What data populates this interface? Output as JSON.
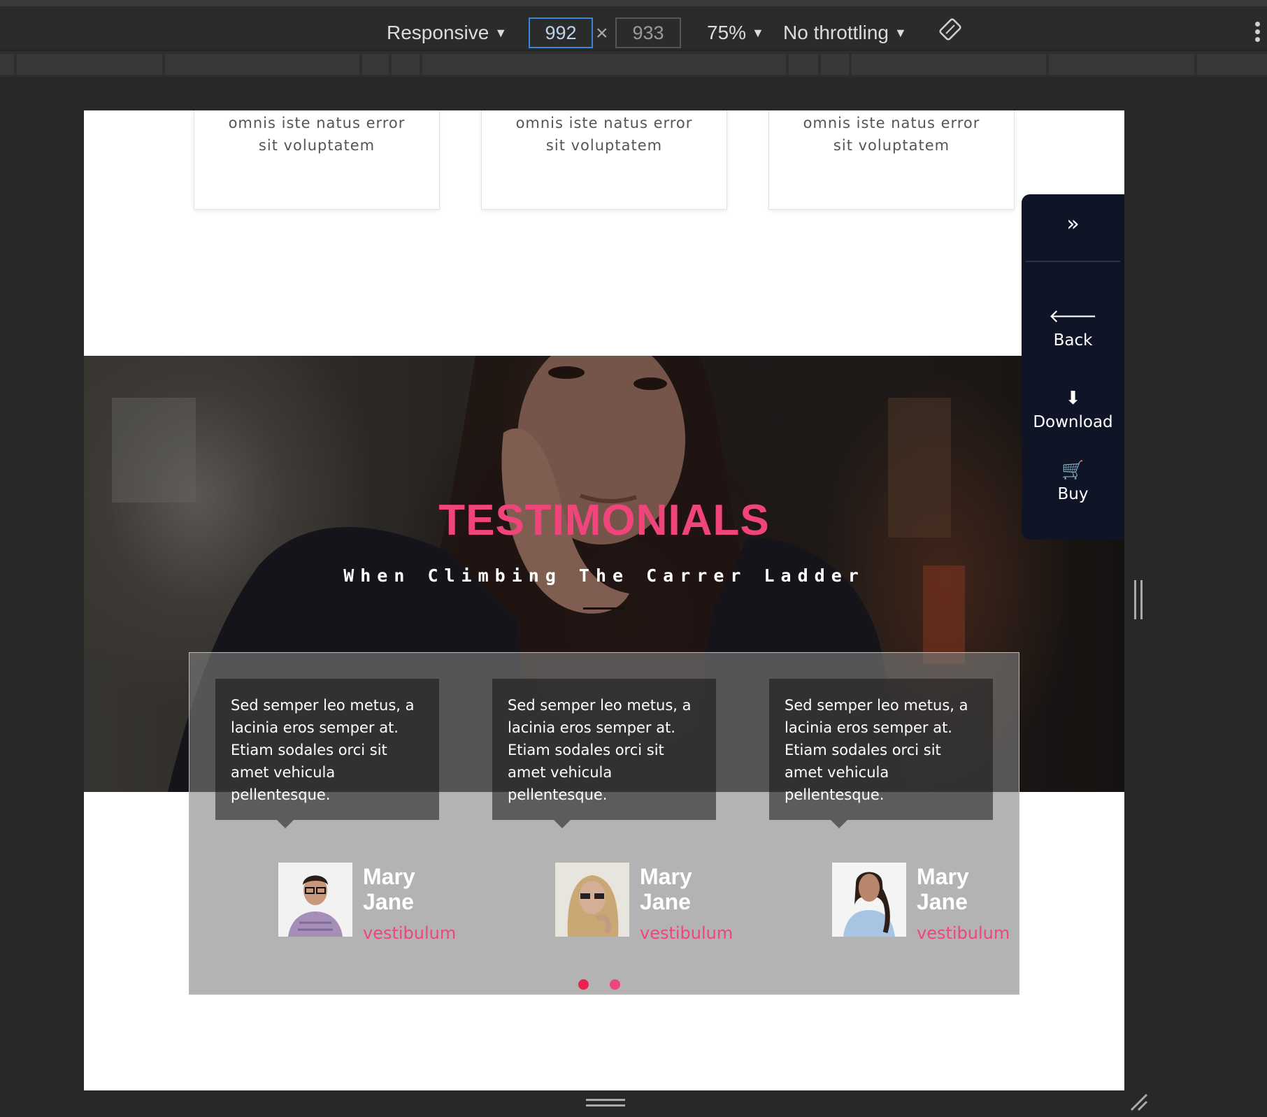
{
  "devtools": {
    "device_label": "Responsive",
    "width_value": "992",
    "height_value": "933",
    "times_symbol": "×",
    "zoom_label": "75%",
    "throttling_label": "No throttling",
    "caret": "▼",
    "rotate_icon": "rotate-icon",
    "more_icon": "more-vertical-icon"
  },
  "services": {
    "cards": [
      {
        "line1": "omnis iste natus error",
        "line2": "sit voluptatem"
      },
      {
        "line1": "omnis iste natus error",
        "line2": "sit voluptatem"
      },
      {
        "line1": "omnis iste natus error",
        "line2": "sit voluptatem"
      }
    ]
  },
  "hero": {
    "title": "TESTIMONIALS",
    "subtitle": "When Climbing The Carrer Ladder"
  },
  "testimonials": [
    {
      "quote": "Sed semper leo metus, a lacinia eros semper at. Etiam sodales orci sit amet vehicula pellentesque.",
      "first": "Mary",
      "last": "Jane",
      "role": "vestibulum"
    },
    {
      "quote": "Sed semper leo metus, a lacinia eros semper at. Etiam sodales orci sit amet vehicula pellentesque.",
      "first": "Mary",
      "last": "Jane",
      "role": "vestibulum"
    },
    {
      "quote": "Sed semper leo metus, a lacinia eros semper at. Etiam sodales orci sit amet vehicula pellentesque.",
      "first": "Mary",
      "last": "Jane",
      "role": "vestibulum"
    }
  ],
  "side_panel": {
    "collapse_icon": "»",
    "back_icon": "🡐",
    "back_label": "Back",
    "download_icon": "⬇",
    "download_label": "Download",
    "buy_icon": "🛒",
    "buy_label": "Buy"
  },
  "colors": {
    "accent": "#f0457a",
    "panel_bg": "#0f1427",
    "devtools_bg": "#2b2b2b"
  }
}
